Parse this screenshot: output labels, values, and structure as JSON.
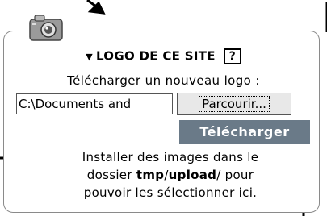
{
  "panel": {
    "title": "LOGO DE CE SITE",
    "help_label": "?",
    "upload_prompt": "Télécharger un nouveau logo :",
    "file_input_value": "C:\\Documents and",
    "browse_button_label": "Parcourir...",
    "upload_button_label": "Télécharger",
    "desc_line1": "Installer des images dans le",
    "desc_line2_pre": "dossier ",
    "desc_line2_path1": "tmp",
    "desc_line2_sep": "/",
    "desc_line2_path2": "upload",
    "desc_line2_post": "/ pour",
    "desc_line3": "pouvoir les sélectionner ici."
  },
  "icons": {
    "title_triangle": "▼",
    "camera": "camera-icon"
  },
  "colors": {
    "upload_button_bg": "#6a7a88",
    "panel_border": "#8a8a8a"
  }
}
